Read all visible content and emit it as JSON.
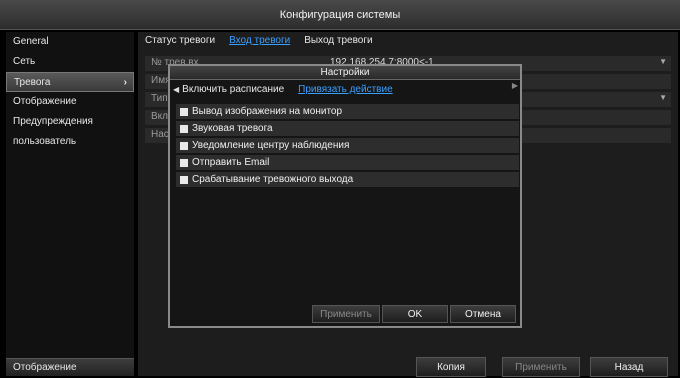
{
  "window": {
    "title": "Конфигурация системы"
  },
  "sidebar": {
    "items": [
      {
        "label": "General",
        "active": false
      },
      {
        "label": "Сеть",
        "active": false
      },
      {
        "label": "Тревога",
        "active": true
      },
      {
        "label": "Отображение",
        "active": false
      },
      {
        "label": "Предупреждения",
        "active": false
      },
      {
        "label": "пользователь",
        "active": false
      }
    ],
    "bottom_label": "Отображение"
  },
  "main": {
    "tabs": [
      {
        "label": "Статус тревоги",
        "active": false
      },
      {
        "label": "Вход тревоги",
        "active": true
      },
      {
        "label": "Выход тревоги",
        "active": false
      }
    ],
    "fields": [
      {
        "label": "№ трев.вх.",
        "value": "192.168.254.7:8000<-1"
      },
      {
        "label": "Имя",
        "value": ""
      },
      {
        "label": "Тип",
        "value": ""
      },
      {
        "label": "Вкл",
        "value": ""
      },
      {
        "label": "Нас",
        "value": ""
      }
    ],
    "buttons": {
      "copy": "Копия",
      "apply": "Применить",
      "back": "Назад"
    }
  },
  "dialog": {
    "title": "Настройки",
    "tabs": [
      {
        "label": "Включить расписание",
        "active": false
      },
      {
        "label": "Привязать действие",
        "active": true
      }
    ],
    "options": [
      {
        "label": "Вывод изображения на монитор",
        "checked": true
      },
      {
        "label": "Звуковая тревога",
        "checked": true
      },
      {
        "label": "Уведомление центру наблюдения",
        "checked": true
      },
      {
        "label": "Отправить Email",
        "checked": true
      },
      {
        "label": "Срабатывание тревожного выхода",
        "checked": true
      }
    ],
    "buttons": {
      "apply": "Применить",
      "ok": "OK",
      "cancel": "Отмена"
    }
  }
}
